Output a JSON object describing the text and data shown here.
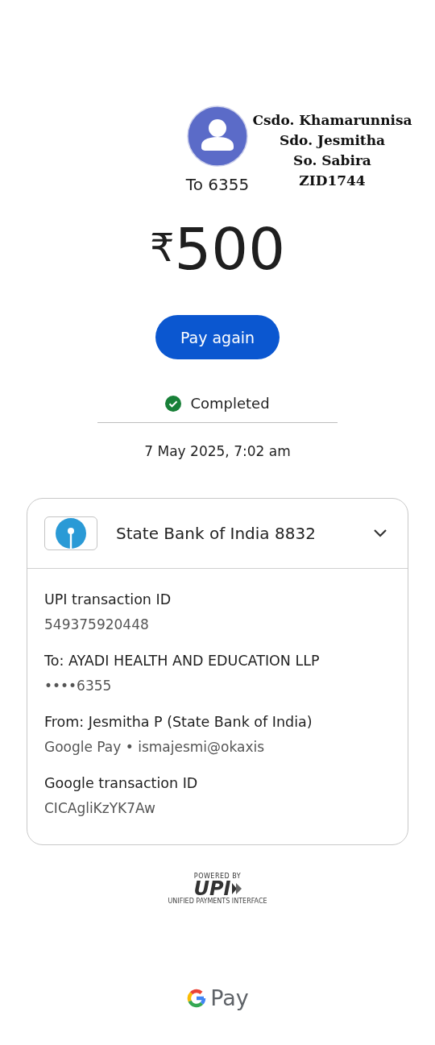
{
  "recipient": {
    "label": "To 6355"
  },
  "annotation": [
    "Csdo. Khamarunnisa",
    "Sdo. Jesmitha",
    "So. Sabira",
    "ZID1744"
  ],
  "amount": {
    "currency": "₹",
    "value": "500"
  },
  "pay_again_button": "Pay again",
  "status": {
    "label": "Completed",
    "kind": "completed"
  },
  "date": "7 May 2025, 7:02 am",
  "account": {
    "name": "State Bank of India 8832",
    "expanded": true
  },
  "details": [
    {
      "label": "UPI transaction ID",
      "value": "549375920448"
    },
    {
      "label": "To: AYADI HEALTH AND EDUCATION LLP",
      "value": "••••6355"
    },
    {
      "label": "From: Jesmitha  P (State Bank of India)",
      "value": "Google Pay • ismajesmi@okaxis"
    },
    {
      "label": "Google transaction ID",
      "value": "CICAgliKzYK7Aw"
    }
  ],
  "upi_logo": {
    "powered_by": "POWERED BY",
    "name": "UPI",
    "tagline": "UNIFIED PAYMENTS INTERFACE"
  },
  "footer": {
    "brand": "Pay"
  }
}
